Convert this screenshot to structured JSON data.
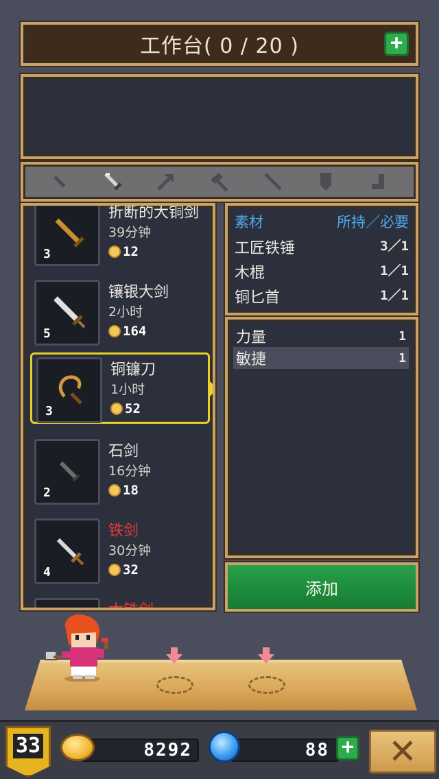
{
  "header": {
    "title": "工作台( 0 / 20 )",
    "add_icon": "plus-icon"
  },
  "tabs": [
    {
      "icon": "dagger-icon",
      "selected": false
    },
    {
      "icon": "sword-icon",
      "selected": true
    },
    {
      "icon": "axe-icon",
      "selected": false
    },
    {
      "icon": "hammer-icon",
      "selected": false
    },
    {
      "icon": "spear-icon",
      "selected": false
    },
    {
      "icon": "shield-icon",
      "selected": false
    },
    {
      "icon": "boot-icon",
      "selected": false
    }
  ],
  "recipes": [
    {
      "name": "折断的大铜剑",
      "time": "39分钟",
      "price": "12",
      "level": "3",
      "color": "#c9902e",
      "name_color": "normal"
    },
    {
      "name": "镶银大剑",
      "time": "2小时",
      "price": "164",
      "level": "5",
      "color": "#d7d7d7",
      "name_color": "normal"
    },
    {
      "name": "铜镰刀",
      "time": "1小时",
      "price": "52",
      "level": "3",
      "color": "#c9902e",
      "name_color": "normal",
      "selected": true
    },
    {
      "name": "石剑",
      "time": "16分钟",
      "price": "18",
      "level": "2",
      "color": "#777777",
      "name_color": "normal"
    },
    {
      "name": "铁剑",
      "time": "30分钟",
      "price": "32",
      "level": "4",
      "color": "#d7d7d7",
      "name_color": "red"
    },
    {
      "name": "木铁剑",
      "time": "",
      "price": "",
      "level": "",
      "color": "#a06a30",
      "name_color": "red"
    }
  ],
  "materials": {
    "header_left": "素材",
    "header_right": "所持／必要",
    "rows": [
      {
        "name": "工匠铁锤",
        "count": "3／1"
      },
      {
        "name": "木棍",
        "count": "1／1"
      },
      {
        "name": "铜匕首",
        "count": "1／1"
      }
    ]
  },
  "stats": [
    {
      "name": "力量",
      "value": "1"
    },
    {
      "name": "敏捷",
      "value": "1"
    }
  ],
  "add_button": {
    "label": "添加"
  },
  "footer": {
    "level": "33",
    "gold": "8292",
    "gems": "88",
    "gold_icon": "coin-icon",
    "gem_icon": "gem-icon",
    "close_icon": "close-icon"
  }
}
